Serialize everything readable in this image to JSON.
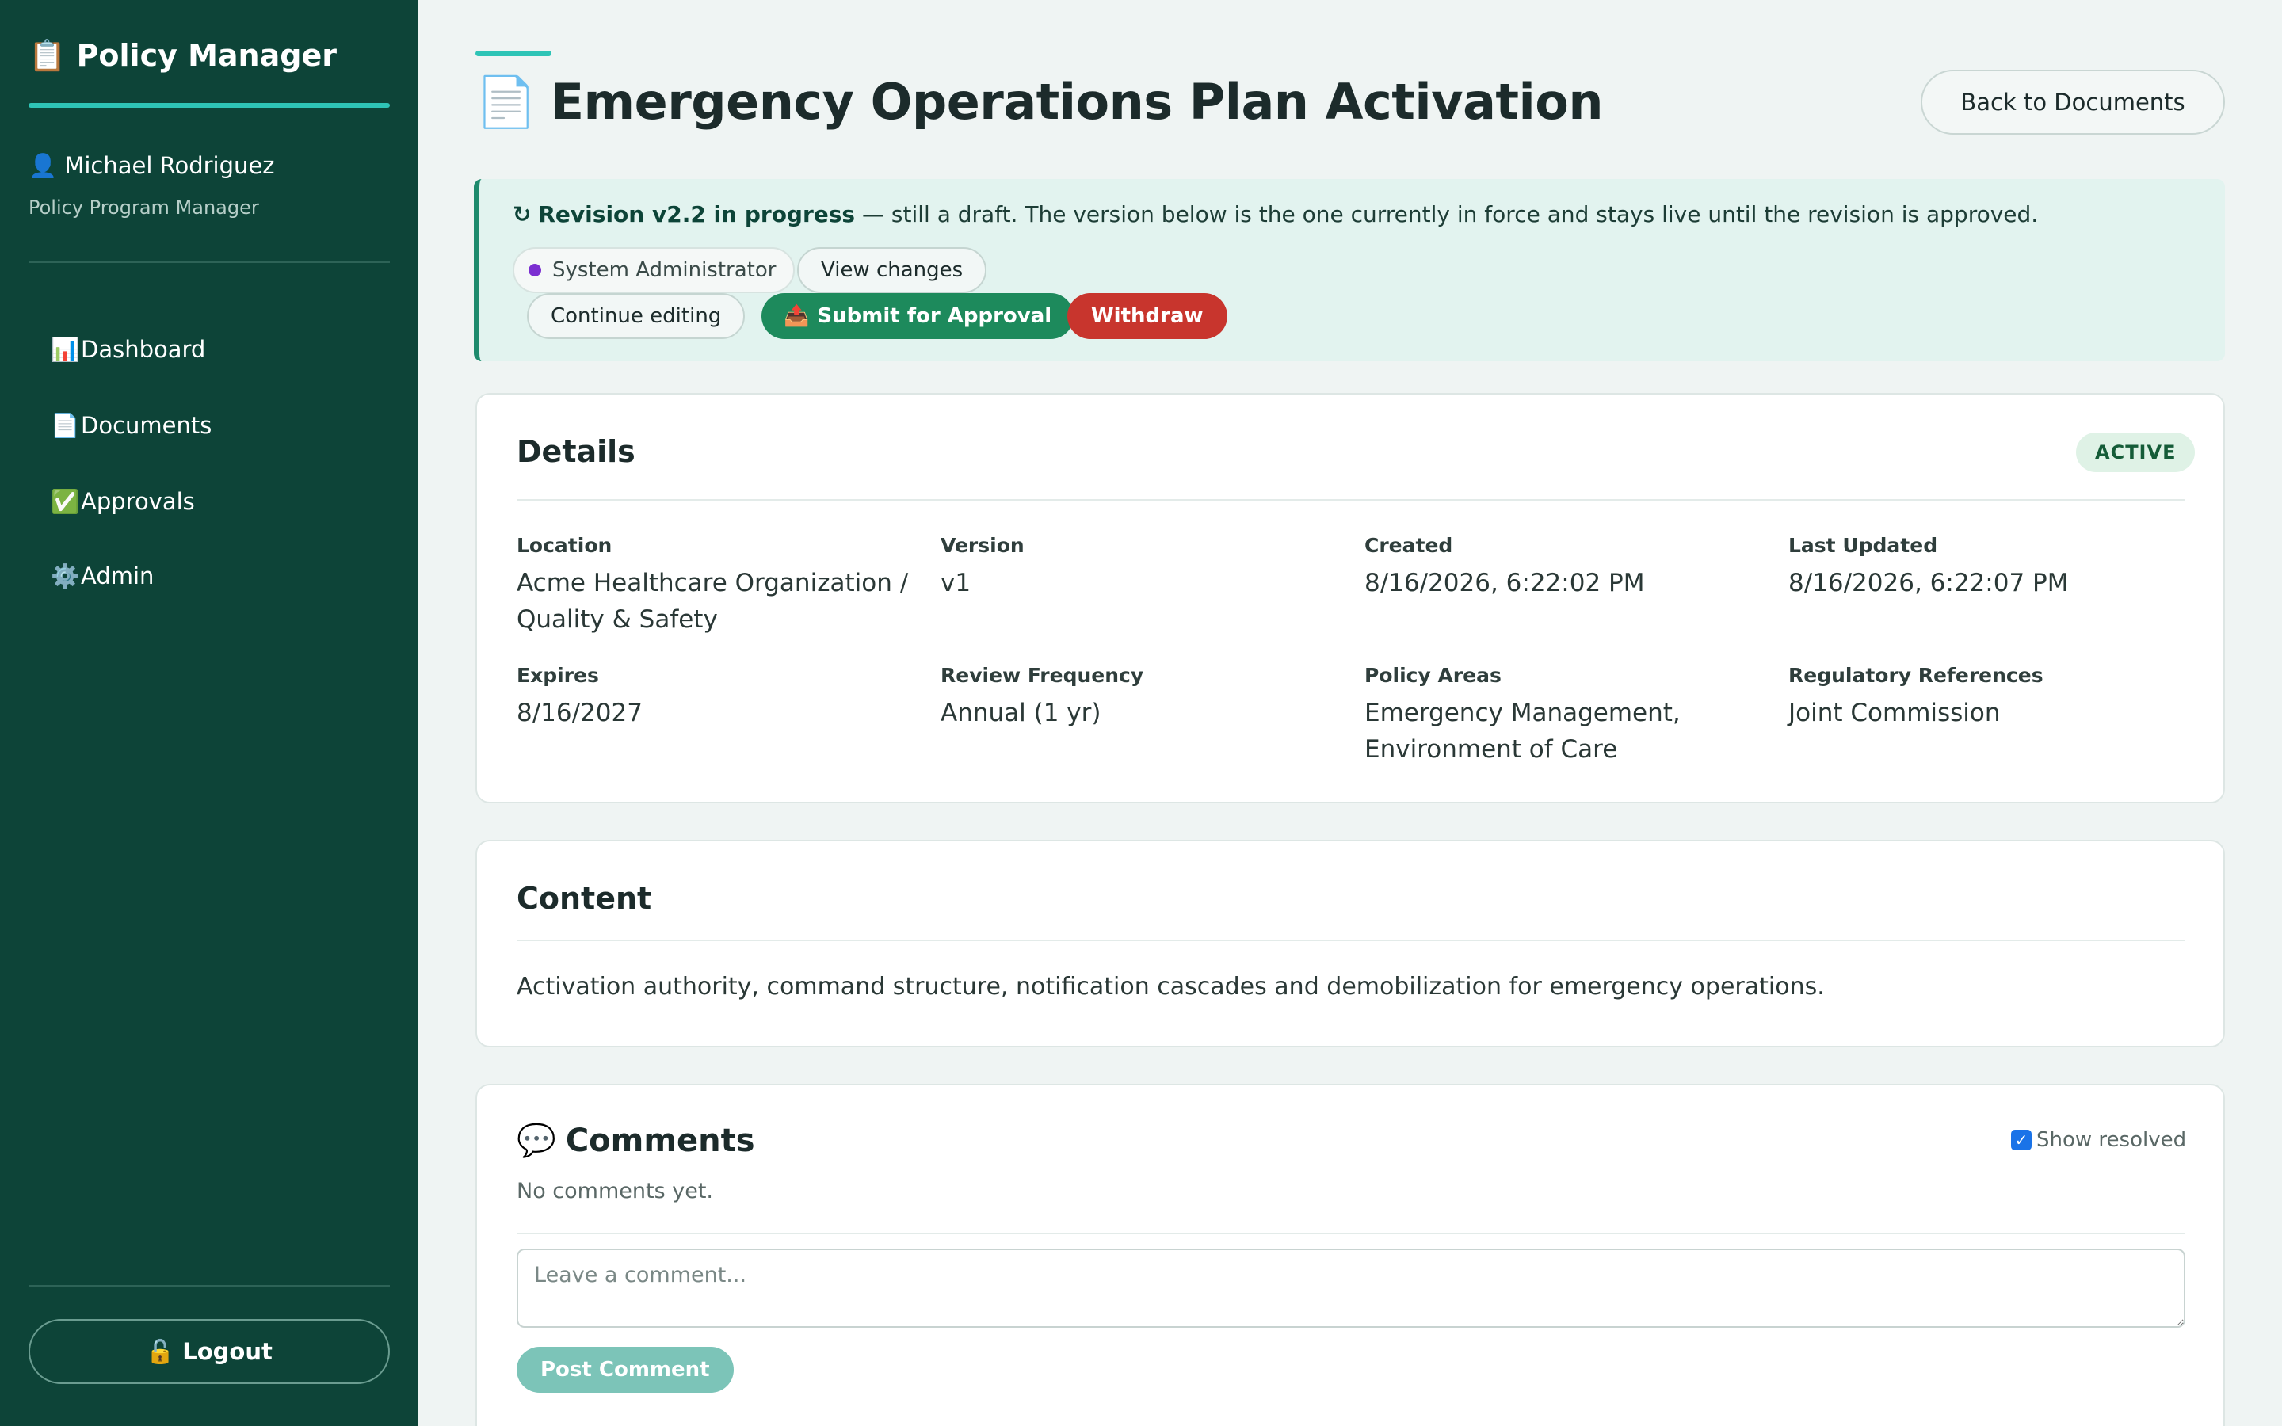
{
  "sidebar": {
    "brand_icon": "📋",
    "brand": "Policy Manager",
    "user_icon": "👤",
    "user_name": "Michael Rodriguez",
    "user_role": "Policy Program Manager",
    "nav": [
      {
        "icon": "📊",
        "label": "Dashboard"
      },
      {
        "icon": "📄",
        "label": "Documents"
      },
      {
        "icon": "✅",
        "label": "Approvals"
      },
      {
        "icon": "⚙️",
        "label": "Admin"
      }
    ],
    "logout_icon": "🔓",
    "logout_label": "Logout"
  },
  "header": {
    "title_icon": "📄",
    "title": "Emergency Operations Plan Activation",
    "back_label": "Back to Documents"
  },
  "revision": {
    "icon": "↻",
    "title": "Revision v2.2 in progress",
    "message": " — still a draft. The version below is the one currently in force and stays live until the revision is approved.",
    "author": "System Administrator",
    "view_changes": "View changes",
    "continue_editing": "Continue editing",
    "submit_icon": "📤",
    "submit": "Submit for Approval",
    "withdraw": "Withdraw"
  },
  "details": {
    "title": "Details",
    "status": "ACTIVE",
    "fields": [
      {
        "label": "Location",
        "value": "Acme Healthcare Organization / Quality & Safety"
      },
      {
        "label": "Version",
        "value": "v1"
      },
      {
        "label": "Created",
        "value": "8/16/2026, 6:22:02 PM"
      },
      {
        "label": "Last Updated",
        "value": "8/16/2026, 6:22:07 PM"
      },
      {
        "label": "Expires",
        "value": "8/16/2027"
      },
      {
        "label": "Review Frequency",
        "value": "Annual (1 yr)"
      },
      {
        "label": "Policy Areas",
        "value": "Emergency Management, Environment of Care"
      },
      {
        "label": "Regulatory References",
        "value": "Joint Commission"
      }
    ]
  },
  "content": {
    "title": "Content",
    "text": "Activation authority, command structure, notification cascades and demobilization for emergency operations."
  },
  "comments": {
    "icon": "💬",
    "title": "Comments",
    "show_resolved": "Show resolved",
    "show_resolved_checked": true,
    "empty": "No comments yet.",
    "placeholder": "Leave a comment...",
    "post": "Post Comment"
  },
  "colors": {
    "sidebar_bg": "#0d4438",
    "accent": "#2ec4b6",
    "submit": "#1d8a5c",
    "withdraw": "#c8352d"
  }
}
